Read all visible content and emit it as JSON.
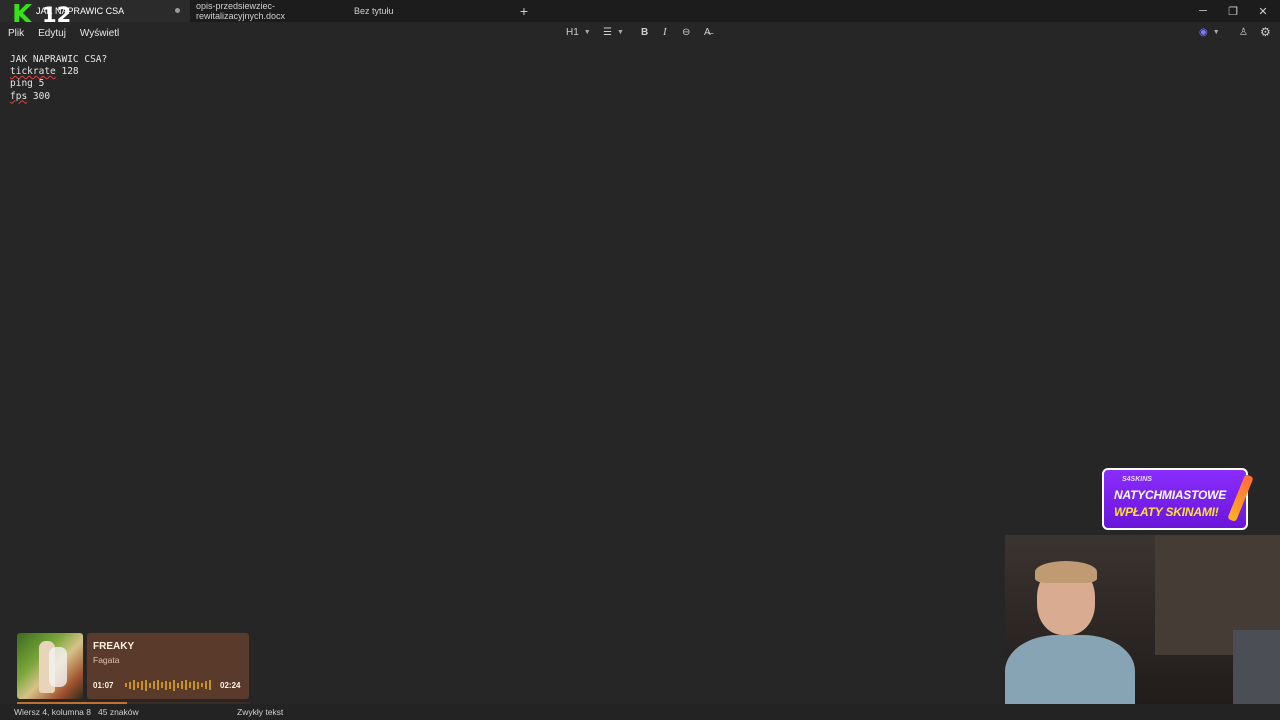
{
  "tabs": [
    {
      "title": "JAK NAPRAWIC CSA",
      "active": true,
      "modified": true
    },
    {
      "title": "opis-przedsiewziec-rewitalizacyjnych.docx"
    },
    {
      "title": "Bez tytułu"
    }
  ],
  "new_tab_glyph": "+",
  "window_controls": {
    "minimize": "─",
    "maximize": "❐",
    "close": "✕"
  },
  "logo": {
    "letter": "K",
    "number": "12",
    "color": "#38e018"
  },
  "menu": [
    "Plik",
    "Edytuj",
    "Wyświetl"
  ],
  "toolbar": {
    "heading": "H1",
    "list_glyph": "☰",
    "bold": "B",
    "italic": "I",
    "link_glyph": "⊖",
    "clear_glyph": "A̶"
  },
  "right_toolbar": {
    "copilot_glyph": "◉",
    "account_glyph": "♙",
    "settings_glyph": "⚙"
  },
  "editor": {
    "lines": [
      {
        "text": "JAK NAPRAWIC CSA?"
      },
      {
        "word": "tickrate",
        "rest": " 128",
        "misspelled": true
      },
      {
        "word": "ping",
        "rest": " 5",
        "misspelled": false
      },
      {
        "word": "fps",
        "rest": " 300",
        "misspelled": true
      }
    ]
  },
  "status": {
    "position": "Wiersz 4, kolumna 8",
    "chars": "45 znaków",
    "format": "Zwykły tekst"
  },
  "music": {
    "title": "FREAKY",
    "artist": "Fagata",
    "elapsed": "01:07",
    "duration": "02:24",
    "progress": 0.47
  },
  "ad": {
    "brand": "S4SKINS",
    "line1": "NATYCHMIASTOWE",
    "line2": "WPŁATY SKINAMI!"
  },
  "colors": {
    "background": "#262626",
    "titlebar": "#1c1c1c",
    "music_card": "#5a3a2a",
    "ad": "#7a22ee"
  }
}
